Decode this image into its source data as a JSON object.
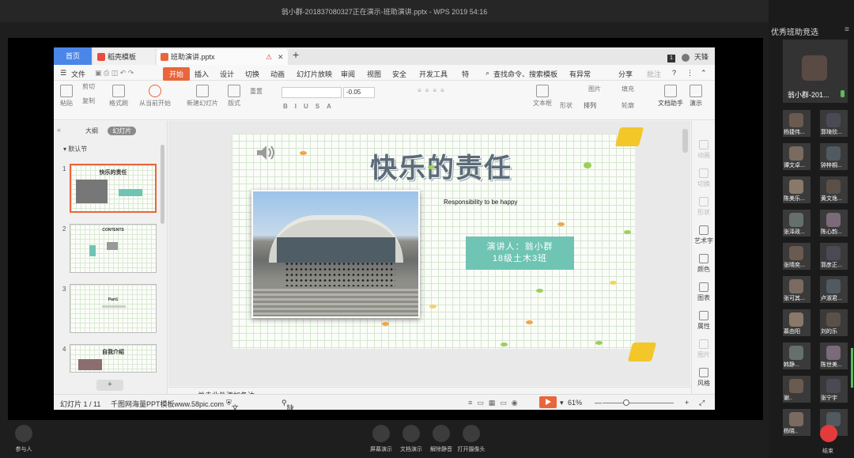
{
  "meeting": {
    "title": "翁小群-201837080327正在演示-班助演讲.pptx - WPS 2019 54:16",
    "panel_title": "优秀班助竞选",
    "main_speaker": "翁小群-201...",
    "participants": [
      "杨捷伟...",
      "郭琦欣...",
      "谭文卓...",
      "钟梓桐...",
      "陈美乐...",
      "黄文逸...",
      "张泽政...",
      "陈心韵...",
      "张晴奕...",
      "郭彦正...",
      "张可其...",
      "卢淑君...",
      "慕由阳",
      "刘的乐",
      "韩静...",
      "陈世美...",
      "谢..",
      "张宁宇",
      "杨晓..",
      ""
    ],
    "controls": {
      "participants": "参与人",
      "screen_share": "屏幕演示",
      "doc_share": "文档演示",
      "unmute": "解除静音",
      "camera": "打开摄像头",
      "end": "结束"
    }
  },
  "wps": {
    "tabs": {
      "home": "首页",
      "template": "稻壳模板",
      "file": "班助演讲.pptx"
    },
    "user": "天锋",
    "menu": [
      "文件",
      "开始",
      "插入",
      "设计",
      "切换",
      "动画",
      "幻灯片放映",
      "审阅",
      "视图",
      "安全",
      "开发工具",
      "特"
    ],
    "search": "查找命令、搜索模板",
    "menu_right": {
      "changes": "有异常",
      "share": "分享",
      "comment": "批注"
    },
    "ribbon": {
      "paste": "粘贴",
      "cut": "剪切",
      "copy": "复制",
      "format_painter": "格式刷",
      "from_start": "从当前开始",
      "new_slide": "新建幻灯片",
      "layout": "版式",
      "reset": "重置",
      "font_size": "-0.05",
      "textbox": "文本框",
      "shape": "形状",
      "arrange": "排列",
      "picture": "图片",
      "fill": "填充",
      "outline": "轮廓",
      "doc_helper": "文档助手",
      "present": "演示"
    },
    "left_panel": {
      "outline_tab": "大纲",
      "slides_tab": "幻灯片",
      "section": "默认节",
      "thumbs": [
        {
          "num": "1",
          "title": "快乐的责任"
        },
        {
          "num": "2",
          "title": "CONTENTS"
        },
        {
          "num": "3",
          "title": "Part1"
        },
        {
          "num": "4",
          "title": "自我介绍"
        }
      ]
    },
    "slide": {
      "title": "快乐的责任",
      "subtitle": "Responsibility to be happy",
      "speaker_line1": "演讲人：翁小群",
      "speaker_line2": "18级土木3班"
    },
    "notes_placeholder": "单击此处添加备注",
    "right_tools": {
      "animation": "动画",
      "transition": "切换",
      "shape": "形状",
      "wordart": "艺术字",
      "color": "颜色",
      "chart": "图表",
      "property": "属性",
      "picture": "图片",
      "style": "风格"
    },
    "status": {
      "slide_info": "幻灯片 1 / 11",
      "template_src": "千图网海量PPT模板www.58pic.com",
      "protect": "文档未保护",
      "missing_font": "缺失字体",
      "zoom": "61%"
    }
  }
}
